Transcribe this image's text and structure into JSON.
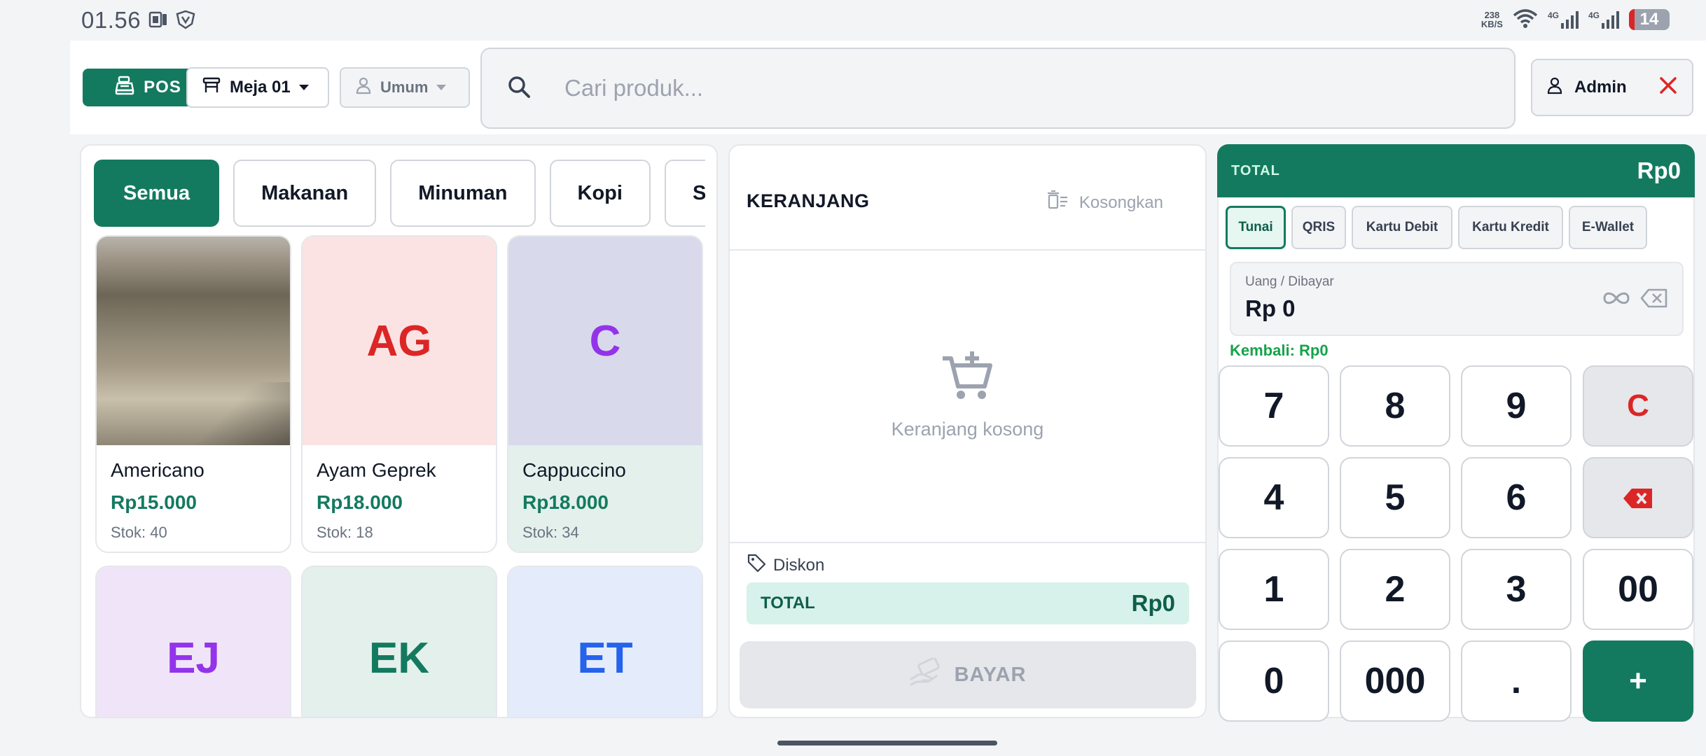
{
  "status_bar": {
    "time": "01.56",
    "net_speed_value": "238",
    "net_speed_unit": "KB/S",
    "net_type_1": "4G",
    "net_type_2": "4G",
    "battery": "14",
    "battery_level": 0.14
  },
  "header": {
    "pos_label": "POS",
    "table_label": "Meja 01",
    "customer_label": "Umum",
    "search_placeholder": "Cari produk...",
    "admin_label": "Admin"
  },
  "categories": [
    "Semua",
    "Makanan",
    "Minuman",
    "Kopi",
    "Snack"
  ],
  "products": [
    {
      "initials": "",
      "name": "Americano",
      "price": "Rp15.000",
      "stock": "Stok: 40",
      "bg": "photo",
      "color": "#111827"
    },
    {
      "initials": "AG",
      "name": "Ayam Geprek",
      "price": "Rp18.000",
      "stock": "Stok: 18",
      "bg": "#fbe3e3",
      "color": "#dc2626"
    },
    {
      "initials": "C",
      "name": "Cappuccino",
      "price": "Rp18.000",
      "stock": "Stok: 34",
      "bg": "#d9d9ec",
      "color": "#9333ea"
    },
    {
      "initials": "EJ",
      "name": "",
      "price": "",
      "stock": "",
      "bg": "#f0e4f8",
      "color": "#9333ea"
    },
    {
      "initials": "EK",
      "name": "",
      "price": "",
      "stock": "",
      "bg": "#e3f0ec",
      "color": "#147a5f"
    },
    {
      "initials": "ET",
      "name": "",
      "price": "",
      "stock": "",
      "bg": "#e4ecfb",
      "color": "#2563eb"
    }
  ],
  "cart": {
    "title": "KERANJANG",
    "clear_label": "Kosongkan",
    "empty_text": "Keranjang kosong",
    "discount_label": "Diskon",
    "total_label": "TOTAL",
    "total_value": "Rp0",
    "pay_label": "BAYAR"
  },
  "payment": {
    "total_label": "TOTAL",
    "total_value": "Rp0",
    "methods": [
      "Tunai",
      "QRIS",
      "Kartu Debit",
      "Kartu Kredit",
      "E-Wallet"
    ],
    "active_method": "Tunai",
    "cash_label": "Uang / Dibayar",
    "cash_value": "Rp 0",
    "change_text": "Kembali: Rp0",
    "keys": [
      "7",
      "8",
      "9",
      "C",
      "4",
      "5",
      "6",
      "⌫",
      "1",
      "2",
      "3",
      "00",
      "0",
      "000",
      ".",
      "+"
    ]
  },
  "colors": {
    "primary": "#147a5f",
    "danger": "#dc2626",
    "success": "#16a34a"
  }
}
